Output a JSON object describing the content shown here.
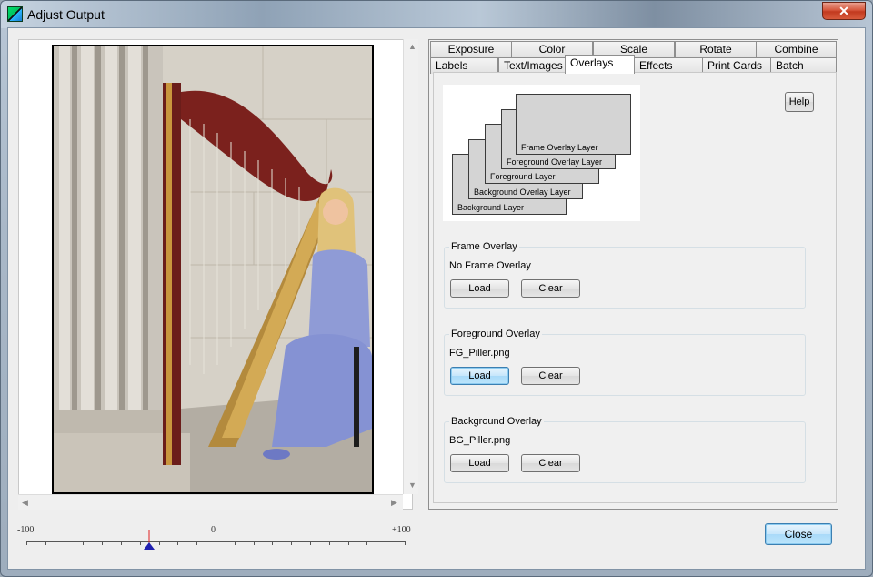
{
  "window": {
    "title": "Adjust Output",
    "close_glyph": "✕"
  },
  "tabs": {
    "row1": [
      "Exposure",
      "Color",
      "Scale",
      "Rotate",
      "Combine"
    ],
    "row2": [
      "Labels",
      "Text/Images",
      "Overlays",
      "Effects",
      "Print Cards",
      "Batch"
    ],
    "active": "Overlays"
  },
  "help_label": "Help",
  "diagram": {
    "layers": [
      "Frame Overlay Layer",
      "Foreground Overlay Layer",
      "Foreground Layer",
      "Background Overlay Layer",
      "Background Layer"
    ]
  },
  "overlays": [
    {
      "title": "Frame Overlay",
      "value": "No Frame Overlay",
      "load_label": "Load",
      "clear_label": "Clear"
    },
    {
      "title": "Foreground Overlay",
      "value": "FG_Piller.png",
      "load_label": "Load",
      "clear_label": "Clear"
    },
    {
      "title": "Background Overlay",
      "value": "BG_Piller.png",
      "load_label": "Load",
      "clear_label": "Clear"
    }
  ],
  "slider": {
    "min_label": "-100",
    "mid_label": "0",
    "max_label": "+100",
    "value": -35
  },
  "close_label": "Close",
  "icons": {
    "app": "app-logo-icon",
    "scroll_up": "scroll-up-arrow-icon",
    "scroll_down": "scroll-down-arrow-icon",
    "scroll_left": "scroll-left-arrow-icon",
    "scroll_right": "scroll-right-arrow-icon",
    "slider_thumb": "slider-thumb-icon"
  },
  "colors": {
    "accent": "#3c7fb1",
    "title_close": "#c23a1f"
  }
}
